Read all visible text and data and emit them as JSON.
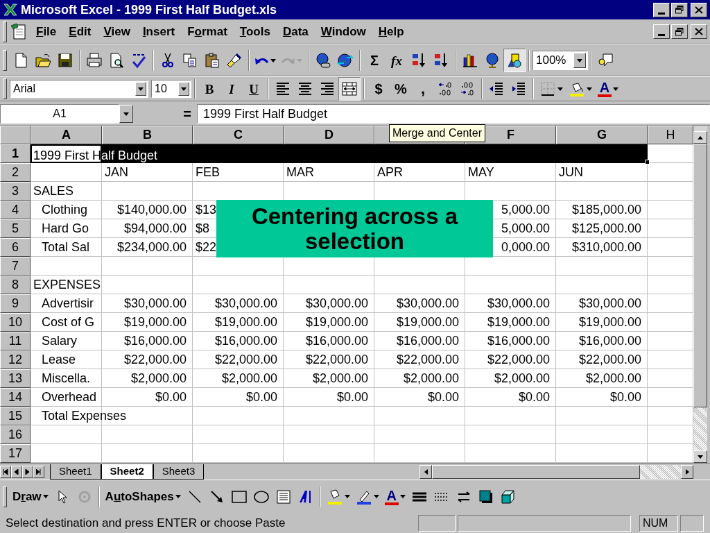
{
  "window": {
    "title": "Microsoft Excel - 1999 First Half Budget.xls"
  },
  "menu": [
    {
      "key": "F",
      "post": "ile"
    },
    {
      "key": "E",
      "post": "dit"
    },
    {
      "key": "V",
      "post": "iew"
    },
    {
      "key": "I",
      "post": "nsert"
    },
    {
      "pre": "F",
      "key": "o",
      "post": "rmat"
    },
    {
      "key": "T",
      "post": "ools"
    },
    {
      "key": "D",
      "post": "ata"
    },
    {
      "key": "W",
      "post": "indow"
    },
    {
      "key": "H",
      "post": "elp"
    }
  ],
  "standard_toolbar": {
    "sum_glyph": "Σ",
    "function_glyph": "fx",
    "drawing_pressed": true,
    "zoom": "100%"
  },
  "formatting_toolbar": {
    "font": "Arial",
    "size": "10",
    "bold_glyph": "B",
    "italic_glyph": "I",
    "underline_glyph": "U",
    "merge_pressed": true,
    "currency_glyph": "$",
    "percent_glyph": "%",
    "comma_glyph": ",",
    "font_color_glyph": "A"
  },
  "formula_bar": {
    "name_box": "A1",
    "equals": "=",
    "content": "1999 First Half Budget"
  },
  "tooltip": "Merge and Center",
  "columns": [
    {
      "label": "A",
      "selected": true
    },
    {
      "label": "B",
      "selected": true
    },
    {
      "label": "C",
      "selected": true
    },
    {
      "label": "D",
      "selected": true
    },
    {},
    {
      "label": "F",
      "selected": true
    },
    {
      "label": "G",
      "selected": true
    },
    {
      "label": "H",
      "selected": false
    }
  ],
  "rows": [
    {
      "number": "1",
      "selected": true,
      "kind": "text",
      "cells": {
        "A": "1999 First Half Budget"
      }
    },
    {
      "number": "2",
      "selected": false,
      "kind": "text",
      "cells": {
        "B": "JAN",
        "C": "FEB",
        "D": "MAR",
        "E": "APR",
        "F": "MAY",
        "G": "JUN"
      }
    },
    {
      "number": "3",
      "selected": false,
      "kind": "text",
      "cells": {
        "A": "SALES"
      }
    },
    {
      "number": "4",
      "selected": false,
      "kind": "values",
      "indent": true,
      "cells": {
        "A": "Clothing",
        "B": "$140,000.00",
        "C": {
          "text": "$13",
          "covered": true
        },
        "F": "5,000.00",
        "G": "$185,000.00"
      }
    },
    {
      "number": "5",
      "selected": false,
      "kind": "values",
      "indent": true,
      "cells": {
        "A": "Hard Go",
        "B": "$94,000.00",
        "C": {
          "text": "$8",
          "covered": true
        },
        "F": "5,000.00",
        "G": "$125,000.00"
      }
    },
    {
      "number": "6",
      "selected": false,
      "kind": "values",
      "indent": true,
      "cells": {
        "A": "Total Sal",
        "B": "$234,000.00",
        "C": {
          "text": "$22",
          "covered": true
        },
        "F": "0,000.00",
        "G": "$310,000.00"
      }
    },
    {
      "number": "7",
      "selected": false,
      "kind": "text"
    },
    {
      "number": "8",
      "selected": false,
      "kind": "text",
      "cells": {
        "A": "EXPENSES"
      }
    },
    {
      "number": "9",
      "selected": false,
      "kind": "values",
      "indent": true,
      "cells": {
        "A": "Advertisir",
        "B": "$30,000.00",
        "C": "$30,000.00",
        "D": "$30,000.00",
        "E": "$30,000.00",
        "F": "$30,000.00",
        "G": "$30,000.00"
      }
    },
    {
      "number": "10",
      "selected": false,
      "kind": "values",
      "indent": true,
      "cells": {
        "A": "Cost of G",
        "B": "$19,000.00",
        "C": "$19,000.00",
        "D": "$19,000.00",
        "E": "$19,000.00",
        "F": "$19,000.00",
        "G": "$19,000.00"
      }
    },
    {
      "number": "11",
      "selected": false,
      "kind": "values",
      "indent": true,
      "cells": {
        "A": "Salary",
        "B": "$16,000.00",
        "C": "$16,000.00",
        "D": "$16,000.00",
        "E": "$16,000.00",
        "F": "$16,000.00",
        "G": "$16,000.00"
      }
    },
    {
      "number": "12",
      "selected": false,
      "kind": "values",
      "indent": true,
      "cells": {
        "A": "Lease",
        "B": "$22,000.00",
        "C": "$22,000.00",
        "D": "$22,000.00",
        "E": "$22,000.00",
        "F": "$22,000.00",
        "G": "$22,000.00"
      }
    },
    {
      "number": "13",
      "selected": false,
      "kind": "values",
      "indent": true,
      "cells": {
        "A": "Miscella.",
        "B": "$2,000.00",
        "C": "$2,000.00",
        "D": "$2,000.00",
        "E": "$2,000.00",
        "F": "$2,000.00",
        "G": "$2,000.00"
      }
    },
    {
      "number": "14",
      "selected": false,
      "kind": "values",
      "indent": true,
      "cells": {
        "A": "Overhead",
        "B": "$0.00",
        "C": "$0.00",
        "D": "$0.00",
        "E": "$0.00",
        "F": "$0.00",
        "G": "$0.00"
      }
    },
    {
      "number": "15",
      "selected": false,
      "kind": "text",
      "indent": true,
      "cells": {
        "A": "Total Expenses"
      }
    },
    {
      "number": "16",
      "selected": false,
      "kind": "text"
    },
    {
      "number": "17",
      "selected": false,
      "kind": "text"
    }
  ],
  "callout": {
    "lines": [
      "Centering across a",
      "selection"
    ]
  },
  "sheet_tabs": [
    {
      "label": "Sheet1",
      "selected": false
    },
    {
      "label": "Sheet2",
      "selected": true
    },
    {
      "label": "Sheet3",
      "selected": false
    }
  ],
  "drawing_toolbar": {
    "draw": {
      "pre": "D",
      "key": "r",
      "post": "aw"
    },
    "autoshapes": {
      "pre": "A",
      "key": "u",
      "post": "toShapes"
    },
    "font_color_glyph": "A"
  },
  "status_bar": {
    "message": "Select destination and press ENTER or choose Paste",
    "indicator": "NUM"
  }
}
